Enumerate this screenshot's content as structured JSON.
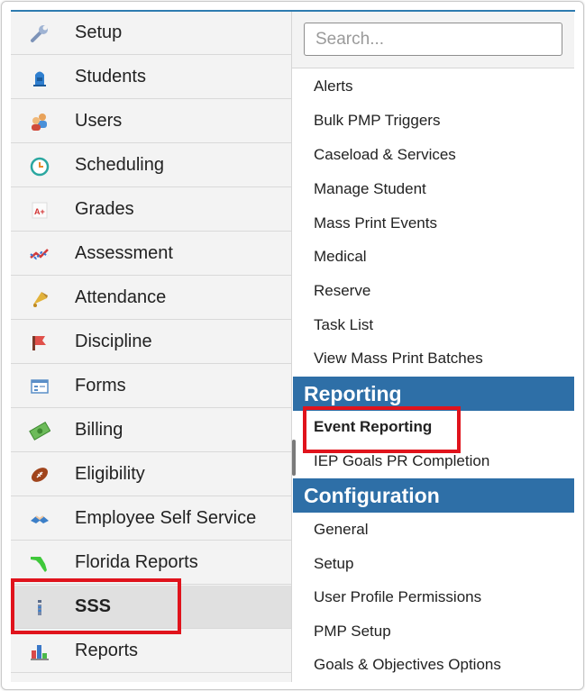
{
  "left_menu": {
    "items": [
      {
        "label": "Setup",
        "icon": "wrench-icon"
      },
      {
        "label": "Students",
        "icon": "student-icon"
      },
      {
        "label": "Users",
        "icon": "users-icon"
      },
      {
        "label": "Scheduling",
        "icon": "clock-icon"
      },
      {
        "label": "Grades",
        "icon": "grades-icon"
      },
      {
        "label": "Assessment",
        "icon": "assessment-chart-icon"
      },
      {
        "label": "Attendance",
        "icon": "bell-icon"
      },
      {
        "label": "Discipline",
        "icon": "discipline-flag-icon"
      },
      {
        "label": "Forms",
        "icon": "form-icon"
      },
      {
        "label": "Billing",
        "icon": "money-icon"
      },
      {
        "label": "Eligibility",
        "icon": "football-icon"
      },
      {
        "label": "Employee Self Service",
        "icon": "handshake-icon"
      },
      {
        "label": "Florida Reports",
        "icon": "florida-map-icon"
      },
      {
        "label": "SSS",
        "icon": "sss-icon",
        "selected": true
      },
      {
        "label": "Reports",
        "icon": "bar-chart-icon"
      }
    ]
  },
  "search": {
    "placeholder": "Search..."
  },
  "submenu": {
    "items": [
      "Alerts",
      "Bulk PMP Triggers",
      "Caseload & Services",
      "Manage Student",
      "Mass Print Events",
      "Medical",
      "Reserve",
      "Task List",
      "View Mass Print Batches"
    ],
    "sections": [
      {
        "title": "Reporting",
        "items": [
          "Event Reporting",
          "IEP Goals PR Completion"
        ]
      },
      {
        "title": "Configuration",
        "items": [
          "General",
          "Setup",
          "User Profile Permissions",
          "PMP Setup",
          "Goals & Objectives Options"
        ]
      }
    ]
  },
  "colors": {
    "accent": "#2e6fa7",
    "highlight": "#e0131c",
    "menu_bg": "#f3f3f3"
  }
}
